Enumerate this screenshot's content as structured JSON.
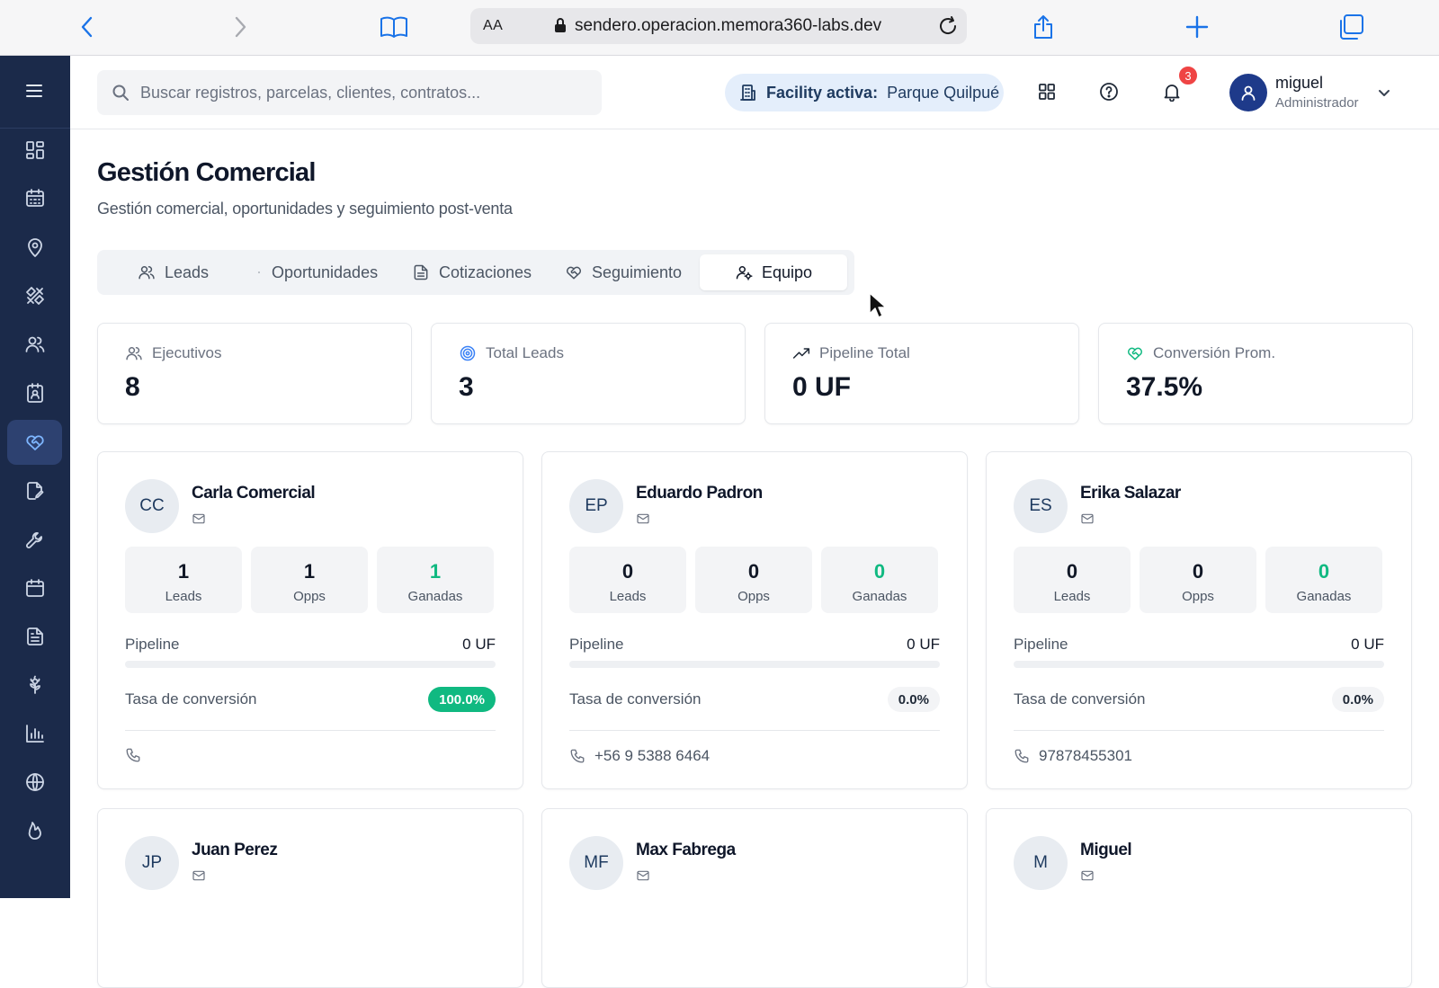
{
  "browser": {
    "text_size_label": "AA",
    "url": "sendero.operacion.memora360-labs.dev"
  },
  "header": {
    "search_placeholder": "Buscar registros, parcelas, clientes, contratos...",
    "facility_label": "Facility activa:",
    "facility_value": "Parque Quilpué",
    "notification_count": "3",
    "user_name": "miguel",
    "user_role": "Administrador"
  },
  "sidebar": {
    "items": [
      {
        "icon": "dashboard-icon",
        "active": false
      },
      {
        "icon": "calendar-grid-icon",
        "active": false
      },
      {
        "icon": "map-pin-icon",
        "active": false
      },
      {
        "icon": "tools-icon",
        "active": false
      },
      {
        "icon": "users-icon",
        "active": false
      },
      {
        "icon": "contact-card-icon",
        "active": false
      },
      {
        "icon": "heart-handshake-icon",
        "active": true
      },
      {
        "icon": "edit-document-icon",
        "active": false
      },
      {
        "icon": "wrench-icon",
        "active": false
      },
      {
        "icon": "calendar-icon",
        "active": false
      },
      {
        "icon": "document-icon",
        "active": false
      },
      {
        "icon": "flower-icon",
        "active": false
      },
      {
        "icon": "bar-chart-icon",
        "active": false
      },
      {
        "icon": "globe-icon",
        "active": false
      },
      {
        "icon": "flame-icon",
        "active": false
      }
    ]
  },
  "page": {
    "title": "Gestión Comercial",
    "subtitle": "Gestión comercial, oportunidades y seguimiento post-venta"
  },
  "tabs": [
    {
      "label": "Leads",
      "icon": "users-icon",
      "active": false
    },
    {
      "label": "Oportunidades",
      "icon": "dot-icon",
      "active": false
    },
    {
      "label": "Cotizaciones",
      "icon": "file-icon",
      "active": false
    },
    {
      "label": "Seguimiento",
      "icon": "heart-handshake-icon",
      "active": false
    },
    {
      "label": "Equipo",
      "icon": "user-cog-icon",
      "active": true
    }
  ],
  "stats": [
    {
      "label": "Ejecutivos",
      "value": "8",
      "icon": "users-icon",
      "color": "#6b7280"
    },
    {
      "label": "Total Leads",
      "value": "3",
      "icon": "target-icon",
      "color": "#3b82f6"
    },
    {
      "label": "Pipeline Total",
      "value": "0 UF",
      "icon": "trending-up-icon",
      "color": "#1f2937"
    },
    {
      "label": "Conversión Prom.",
      "value": "37.5%",
      "icon": "heart-handshake-icon",
      "color": "#10b981"
    }
  ],
  "metric_labels": {
    "leads": "Leads",
    "opps": "Opps",
    "won": "Ganadas",
    "pipeline": "Pipeline",
    "conversion": "Tasa de conversión"
  },
  "team": [
    {
      "initials": "CC",
      "name": "Carla Comercial",
      "leads": "1",
      "opps": "1",
      "won": "1",
      "pipeline": "0 UF",
      "pipeline_fraction": 0,
      "conversion": "100.0%",
      "highlight": true,
      "phone": ""
    },
    {
      "initials": "EP",
      "name": "Eduardo Padron",
      "leads": "0",
      "opps": "0",
      "won": "0",
      "pipeline": "0 UF",
      "pipeline_fraction": 0,
      "conversion": "0.0%",
      "highlight": false,
      "phone": "+56 9 5388 6464"
    },
    {
      "initials": "ES",
      "name": "Erika Salazar",
      "leads": "0",
      "opps": "0",
      "won": "0",
      "pipeline": "0 UF",
      "pipeline_fraction": 0,
      "conversion": "0.0%",
      "highlight": false,
      "phone": "97878455301"
    },
    {
      "initials": "JP",
      "name": "Juan Perez"
    },
    {
      "initials": "MF",
      "name": "Max Fabrega"
    },
    {
      "initials": "M",
      "name": "Miguel"
    }
  ],
  "colors": {
    "sidebar_bg": "#1b2a4a",
    "accent_green": "#10b981",
    "accent_blue": "#1a73e8",
    "badge_red": "#ef4444"
  }
}
